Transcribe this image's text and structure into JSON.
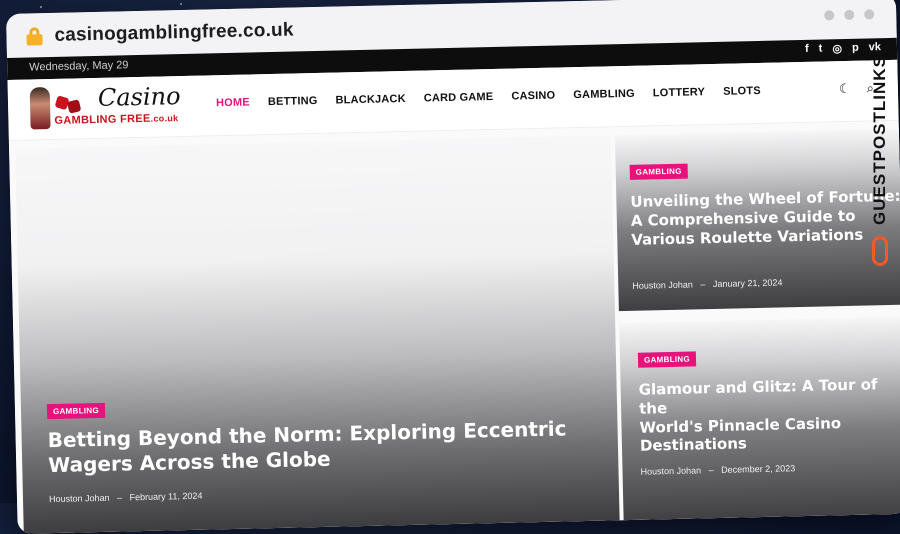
{
  "browser": {
    "url": "casinogamblingfree.co.uk"
  },
  "topbar": {
    "date": "Wednesday, May 29",
    "social_icons": [
      "facebook-icon",
      "twitter-icon",
      "instagram-icon",
      "pinterest-icon",
      "vk-icon"
    ],
    "social_glyphs": [
      "f",
      "t",
      "◎",
      "p",
      "vk"
    ]
  },
  "header": {
    "logo": {
      "script": "Casino",
      "subtitle": "GAMBLING FREE",
      "subtitle_suffix": ".co.uk"
    },
    "nav": [
      {
        "label": "HOME",
        "active": true
      },
      {
        "label": "BETTING",
        "active": false
      },
      {
        "label": "BLACKJACK",
        "active": false
      },
      {
        "label": "CARD GAME",
        "active": false
      },
      {
        "label": "CASINO",
        "active": false
      },
      {
        "label": "GAMBLING",
        "active": false
      },
      {
        "label": "LOTTERY",
        "active": false
      },
      {
        "label": "SLOTS",
        "active": false
      }
    ],
    "icons": {
      "dark_mode": "☾",
      "search": "⌕"
    }
  },
  "hero": {
    "category": "GAMBLING",
    "title_line1": "Betting Beyond the Norm: Exploring Eccentric",
    "title_line2": "Wagers Across the Globe",
    "author": "Houston Johan",
    "date": "February 11, 2024"
  },
  "side_posts": [
    {
      "category": "GAMBLING",
      "title_line1": "Unveiling the Wheel of Fortune:",
      "title_line2": "A Comprehensive Guide to",
      "title_line3": "Various Roulette Variations",
      "author": "Houston Johan",
      "date": "January 21, 2024"
    },
    {
      "category": "GAMBLING",
      "title_line1": "Glamour and Glitz: A Tour of the",
      "title_line2": "World's Pinnacle Casino",
      "title_line3": "Destinations",
      "author": "Houston Johan",
      "date": "December 2, 2023"
    }
  ],
  "watermark": {
    "text": "GUESTPOSTLINKS"
  },
  "colors": {
    "accent": "#e8127c",
    "topbar": "#0d0d0d",
    "lock": "#f6b12b",
    "watermark_chain": "#f05a28"
  }
}
